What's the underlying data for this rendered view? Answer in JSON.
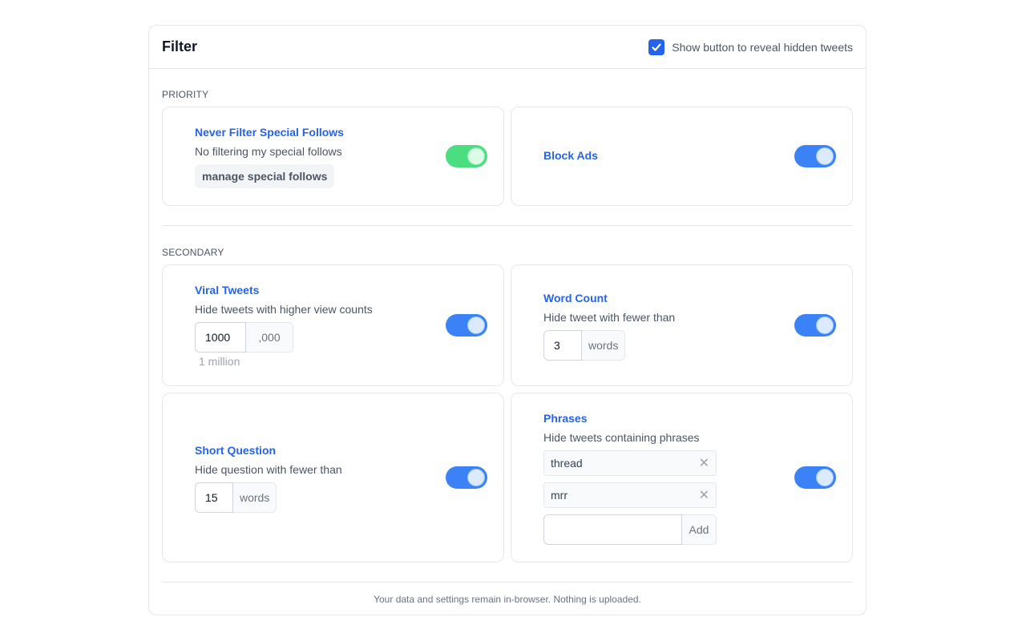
{
  "header": {
    "title": "Filter",
    "reveal_option_label": "Show button to reveal hidden tweets",
    "reveal_option_checked": true
  },
  "sections": {
    "priority_label": "PRIORITY",
    "secondary_label": "SECONDARY"
  },
  "special_follows": {
    "title": "Never Filter Special Follows",
    "description": "No filtering my special follows",
    "button_label": "manage special follows",
    "enabled": true
  },
  "block_ads": {
    "title": "Block Ads",
    "enabled": true
  },
  "viral_tweets": {
    "title": "Viral Tweets",
    "description": "Hide tweets with higher view counts",
    "value": "1000",
    "suffix": ",000",
    "hint": "1 million",
    "enabled": true
  },
  "word_count": {
    "title": "Word Count",
    "description": "Hide tweet with fewer than",
    "value": "3",
    "suffix": "words",
    "enabled": true
  },
  "short_question": {
    "title": "Short Question",
    "description": "Hide question with fewer than",
    "value": "15",
    "suffix": "words",
    "enabled": true
  },
  "phrases": {
    "title": "Phrases",
    "description": "Hide tweets containing phrases",
    "items": [
      "thread",
      "mrr"
    ],
    "new_phrase_value": "",
    "add_label": "Add",
    "enabled": true
  },
  "footer": {
    "note": "Your data and settings remain in-browser. Nothing is uploaded."
  },
  "colors": {
    "accent": "#2563eb",
    "toggle_on": "#3b82f6",
    "toggle_special": "#4ade80"
  }
}
